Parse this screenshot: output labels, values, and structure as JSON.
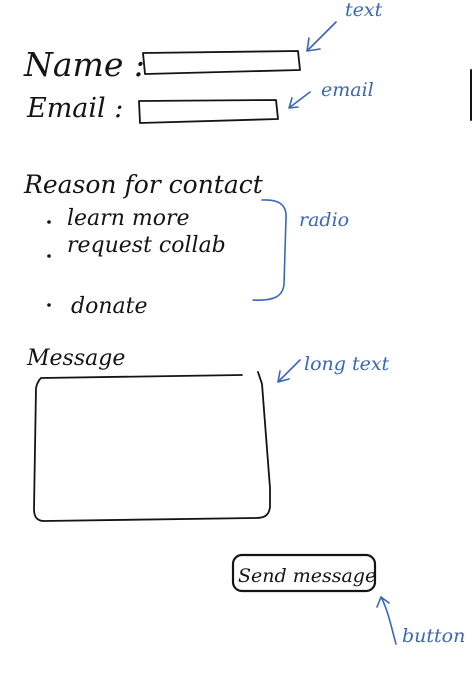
{
  "form": {
    "name_label": "Name :",
    "email_label": "Email :",
    "reason_heading": "Reason for contact",
    "options": [
      "learn more",
      "request collab",
      "donate"
    ],
    "message_label": "Message",
    "send_button_label": "Send message"
  },
  "annotations": {
    "name_note": "text",
    "email_note": "email",
    "reason_note": "radio",
    "message_note": "long text",
    "button_note": "button"
  },
  "colors": {
    "ink": "#141414",
    "annotation": "#3b67b3"
  }
}
